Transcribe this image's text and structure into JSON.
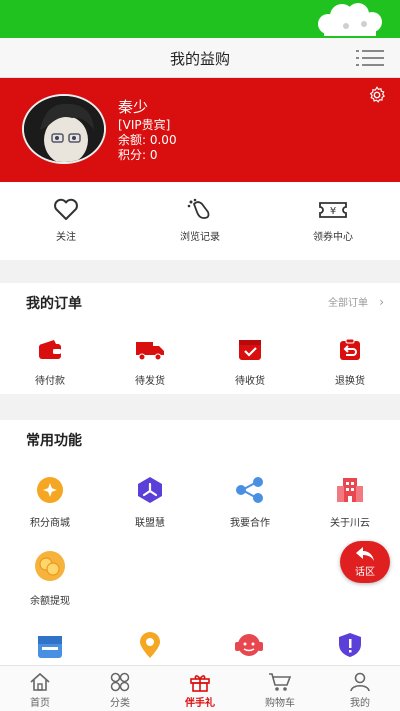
{
  "header": {
    "title": "我的益购"
  },
  "profile": {
    "name": "秦少",
    "level": "[VIP贵宾]",
    "balance": "余额: 0.00",
    "points": "积分: 0"
  },
  "quick_links": [
    {
      "label": "关注",
      "icon": "heart-icon"
    },
    {
      "label": "浏览记录",
      "icon": "footprint-icon"
    },
    {
      "label": "领券中心",
      "icon": "coupon-icon"
    }
  ],
  "orders": {
    "title": "我的订单",
    "all_label": "全部订单",
    "items": [
      {
        "label": "待付款",
        "icon": "wallet-icon"
      },
      {
        "label": "待发货",
        "icon": "truck-icon"
      },
      {
        "label": "待收货",
        "icon": "box-check-icon"
      },
      {
        "label": "退换货",
        "icon": "return-icon"
      }
    ]
  },
  "functions": {
    "title": "常用功能",
    "items": [
      {
        "label": "积分商城",
        "icon": "points-mall-icon"
      },
      {
        "label": "联盟慧",
        "icon": "alliance-icon"
      },
      {
        "label": "我要合作",
        "icon": "cooperate-icon"
      },
      {
        "label": "关于川云",
        "icon": "building-icon"
      },
      {
        "label": "余额提现",
        "icon": "coins-icon"
      }
    ]
  },
  "fab": {
    "label": "话区",
    "icon": "reply-icon"
  },
  "tabs": [
    {
      "label": "首页",
      "icon": "home-icon"
    },
    {
      "label": "分类",
      "icon": "category-icon"
    },
    {
      "label": "伴手礼",
      "icon": "gift-icon",
      "active": true
    },
    {
      "label": "购物车",
      "icon": "cart-icon"
    },
    {
      "label": "我的",
      "icon": "user-icon"
    }
  ],
  "colors": {
    "accent": "#d90f0f",
    "statusbar": "#1fc21f"
  }
}
